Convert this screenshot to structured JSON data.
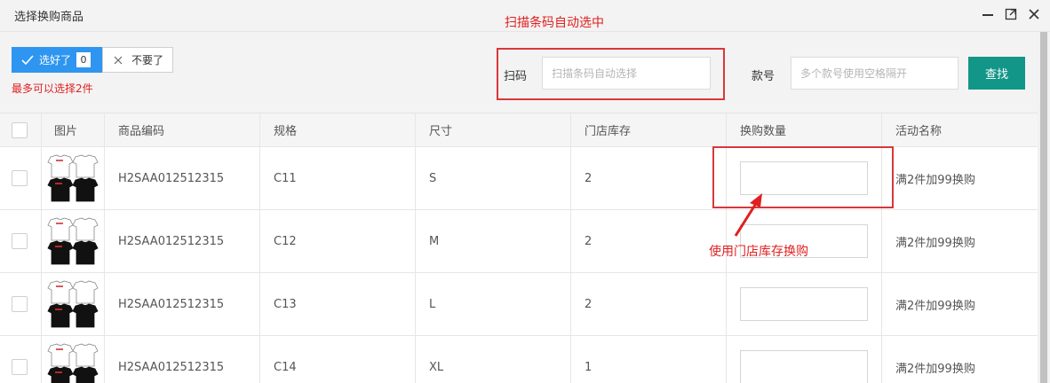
{
  "window": {
    "title": "选择换购商品",
    "controls": [
      "minimize-icon",
      "maximize-icon",
      "close-icon"
    ]
  },
  "annotations": {
    "scan_hint": "扫描条码自动选中",
    "qty_hint": "使用门店库存换购",
    "color": "#e02020"
  },
  "toolbar": {
    "selected_label": "选好了",
    "selected_count": "0",
    "discard_label": "不要了",
    "limit_note": "最多可以选择2件",
    "scan_label": "扫码",
    "scan_placeholder": "扫描条码自动选择",
    "style_label": "款号",
    "style_placeholder": "多个款号使用空格隔开",
    "search_label": "查找",
    "accent": "#2e95f0",
    "search_color": "#129688"
  },
  "table": {
    "headers": [
      "图片",
      "商品编码",
      "规格",
      "尺寸",
      "门店库存",
      "换购数量",
      "活动名称"
    ],
    "rows": [
      {
        "code": "H2SAA012512315",
        "spec": "C11",
        "size": "S",
        "stock": "2",
        "activity": "满2件加99换购"
      },
      {
        "code": "H2SAA012512315",
        "spec": "C12",
        "size": "M",
        "stock": "2",
        "activity": "满2件加99换购"
      },
      {
        "code": "H2SAA012512315",
        "spec": "C13",
        "size": "L",
        "stock": "2",
        "activity": "满2件加99换购"
      },
      {
        "code": "H2SAA012512315",
        "spec": "C14",
        "size": "XL",
        "stock": "1",
        "activity": "满2件加99换购"
      }
    ]
  }
}
